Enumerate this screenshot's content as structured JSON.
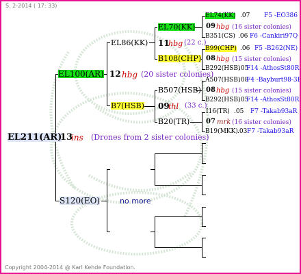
{
  "header": {
    "date": "S. 2-2014 ( 17: 33)"
  },
  "footer": {
    "copyright": "Copyright 2004-2014 @ Karl Kehde Foundation."
  },
  "root": {
    "id": "EL211(AR)",
    "num": "13",
    "group": "ins",
    "note": "(Drones from 2 sister colonies)"
  },
  "gen1": {
    "mother": {
      "id": "EL100(AR)",
      "num": "12",
      "group": "hbg",
      "note": "(20 sister colonies)"
    },
    "father": {
      "id": "S120(EO)",
      "note": "no more"
    }
  },
  "gen2": {
    "a": {
      "id": "EL86(KK)",
      "num": "11",
      "group": "hbg",
      "note": "(22 c.)"
    },
    "b": {
      "id": "B7(HSB)",
      "num": "09",
      "group": "thl",
      "note": "(33 c.)"
    }
  },
  "gen3": {
    "a1": {
      "id": "EL70(KK)"
    },
    "a2": {
      "id": "B108(CHP)"
    },
    "b1": {
      "id": "B507(HSB)"
    },
    "b2": {
      "id": "B20(TR)"
    }
  },
  "gen4": [
    {
      "id": "EL74(KK)",
      "year": ".07",
      "origin": "F5 -EO386"
    },
    {
      "num": "09",
      "group": "hbg",
      "note": "(16 sister colonies)"
    },
    {
      "id": "B351(CS)",
      "year": ".06",
      "origin": "F6 -Cankiri97Q"
    },
    {
      "id": "B99(CHP)",
      "year": ".06",
      "origin": "F5 -B262(NE)"
    },
    {
      "num": "08",
      "group": "hbg",
      "note": "(15 sister colonies)"
    },
    {
      "id": "B292(HSB)",
      "year": ".05",
      "origin": "F14 -AthosSt80R"
    },
    {
      "id": "A507(HSB)",
      "year": ".08",
      "origin": "F4 -Bayburt98-3R"
    },
    {
      "num": "08",
      "group": "hbg",
      "note": "(15 sister colonies)"
    },
    {
      "id": "B292(HSB)",
      "year": ".05",
      "origin": "F14 -AthosSt80R"
    },
    {
      "id": "I16(TR)",
      "year": ".05",
      "origin": "F7 -Takab93aR"
    },
    {
      "num": "07",
      "group": "mrk",
      "note": "(16 sister colonies)"
    },
    {
      "id": "B19(MKK)",
      "year": ".03",
      "origin": "F7 -Takab93aR"
    }
  ],
  "colors": {
    "border": "#e8118f",
    "green": "#16e016",
    "yellow": "#ffff33",
    "group_red": "#cc0000",
    "note_purple": "#7a25c4",
    "origin_blue": "#1a0ee8"
  }
}
